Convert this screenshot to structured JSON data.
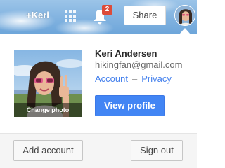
{
  "topbar": {
    "plus_name": "+Keri",
    "apps_icon": "apps-grid-icon",
    "notifications_icon": "bell-icon",
    "notification_count": "2",
    "share_label": "Share",
    "avatar_icon": "profile-avatar"
  },
  "account": {
    "name": "Keri Andersen",
    "email": "hikingfan@gmail.com",
    "account_link": "Account",
    "separator": "–",
    "privacy_link": "Privacy",
    "change_photo": "Change photo",
    "view_profile": "View profile"
  },
  "footer": {
    "add_account": "Add account",
    "sign_out": "Sign out"
  },
  "colors": {
    "primary_button": "#4285f4",
    "link": "#427fed",
    "badge": "#dd4b39",
    "sky": "#7fb1df"
  }
}
